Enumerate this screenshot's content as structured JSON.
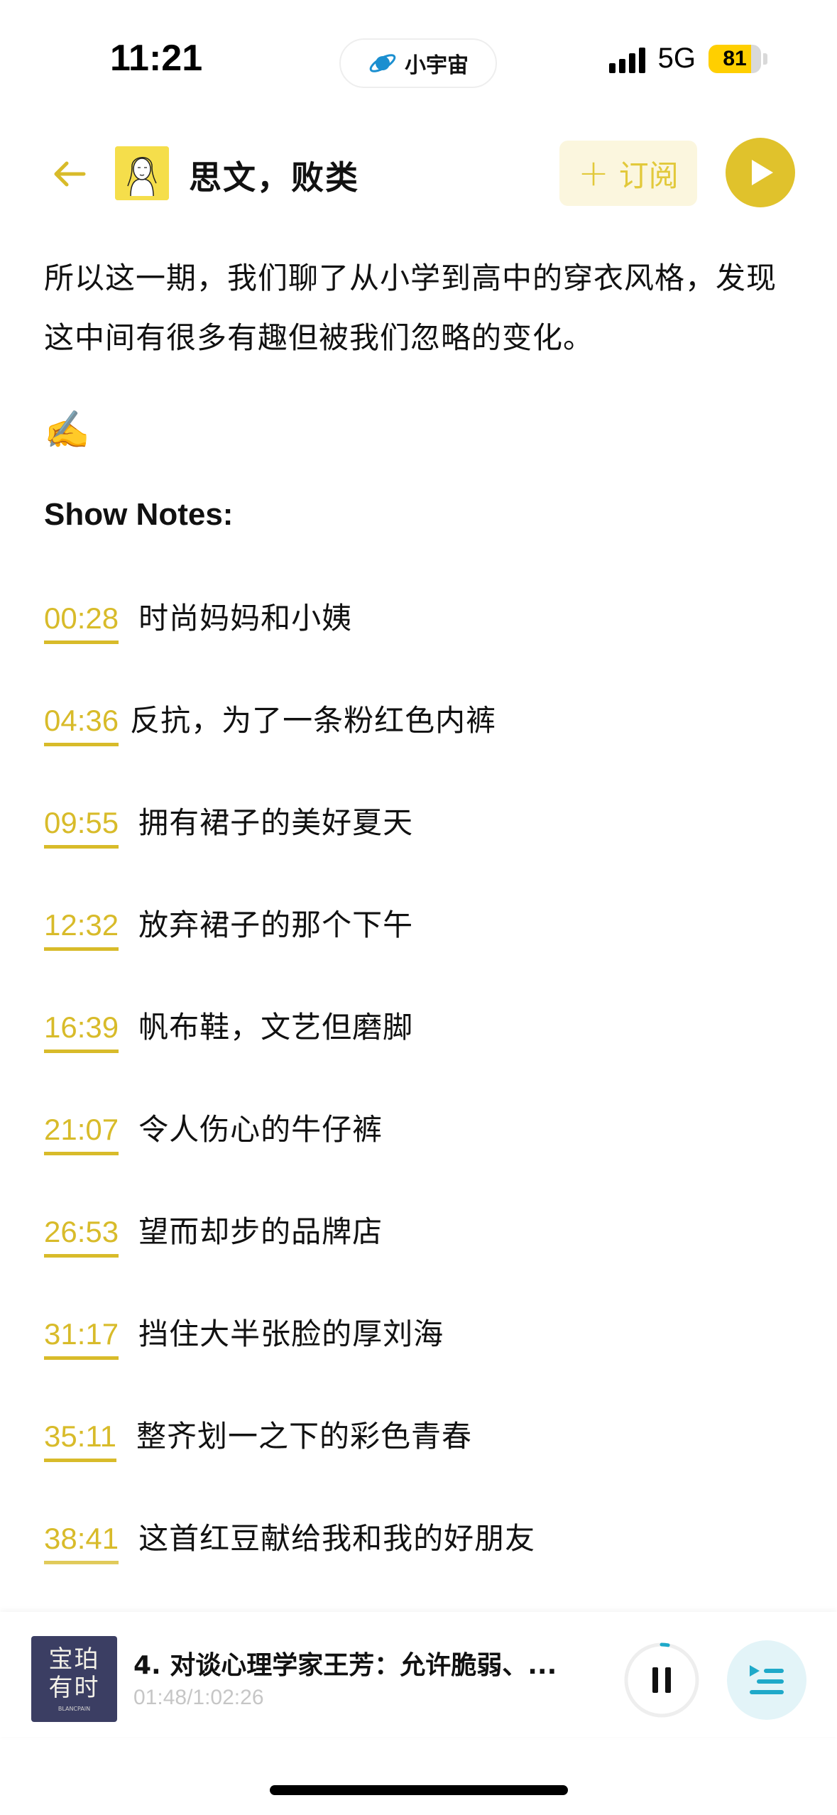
{
  "status_bar": {
    "time": "11:21",
    "app_name": "小宇宙",
    "network": "5G",
    "battery": "81",
    "battery_level": 0.81
  },
  "header": {
    "podcast_title": "思文，败类",
    "subscribe_label": "订阅",
    "accent_color": "#e0c22c"
  },
  "content": {
    "intro": "所以这一期，我们聊了从小学到高中的穿衣风格，发现这中间有很多有趣但被我们忽略的变化。",
    "emoji": "✍️",
    "notes_heading": "Show Notes:",
    "notes": [
      {
        "time": "00:28",
        "text": "时尚妈妈和小姨"
      },
      {
        "time": "04:36",
        "text": "反抗，为了一条粉红色内裤"
      },
      {
        "time": "09:55",
        "text": "拥有裙子的美好夏天"
      },
      {
        "time": "12:32",
        "text": "放弃裙子的那个下午"
      },
      {
        "time": "16:39",
        "text": "帆布鞋，文艺但磨脚"
      },
      {
        "time": "21:07",
        "text": "令人伤心的牛仔裤"
      },
      {
        "time": "26:53",
        "text": "望而却步的品牌店"
      },
      {
        "time": "31:17",
        "text": "挡住大半张脸的厚刘海"
      },
      {
        "time": "35:11",
        "text": "整齐划一之下的彩色青春"
      },
      {
        "time": "38:41",
        "text": "这首红豆献给我和我的好朋友"
      }
    ]
  },
  "player": {
    "cover_text": "宝珀有时",
    "cover_subtext": "BLANCPAIN",
    "episode_title": "4. 对谈心理学家王芳：允许脆弱、...",
    "time": "01:48/1:02:26",
    "progress_fraction": 0.029,
    "playlist_color": "#1fa9c9"
  }
}
